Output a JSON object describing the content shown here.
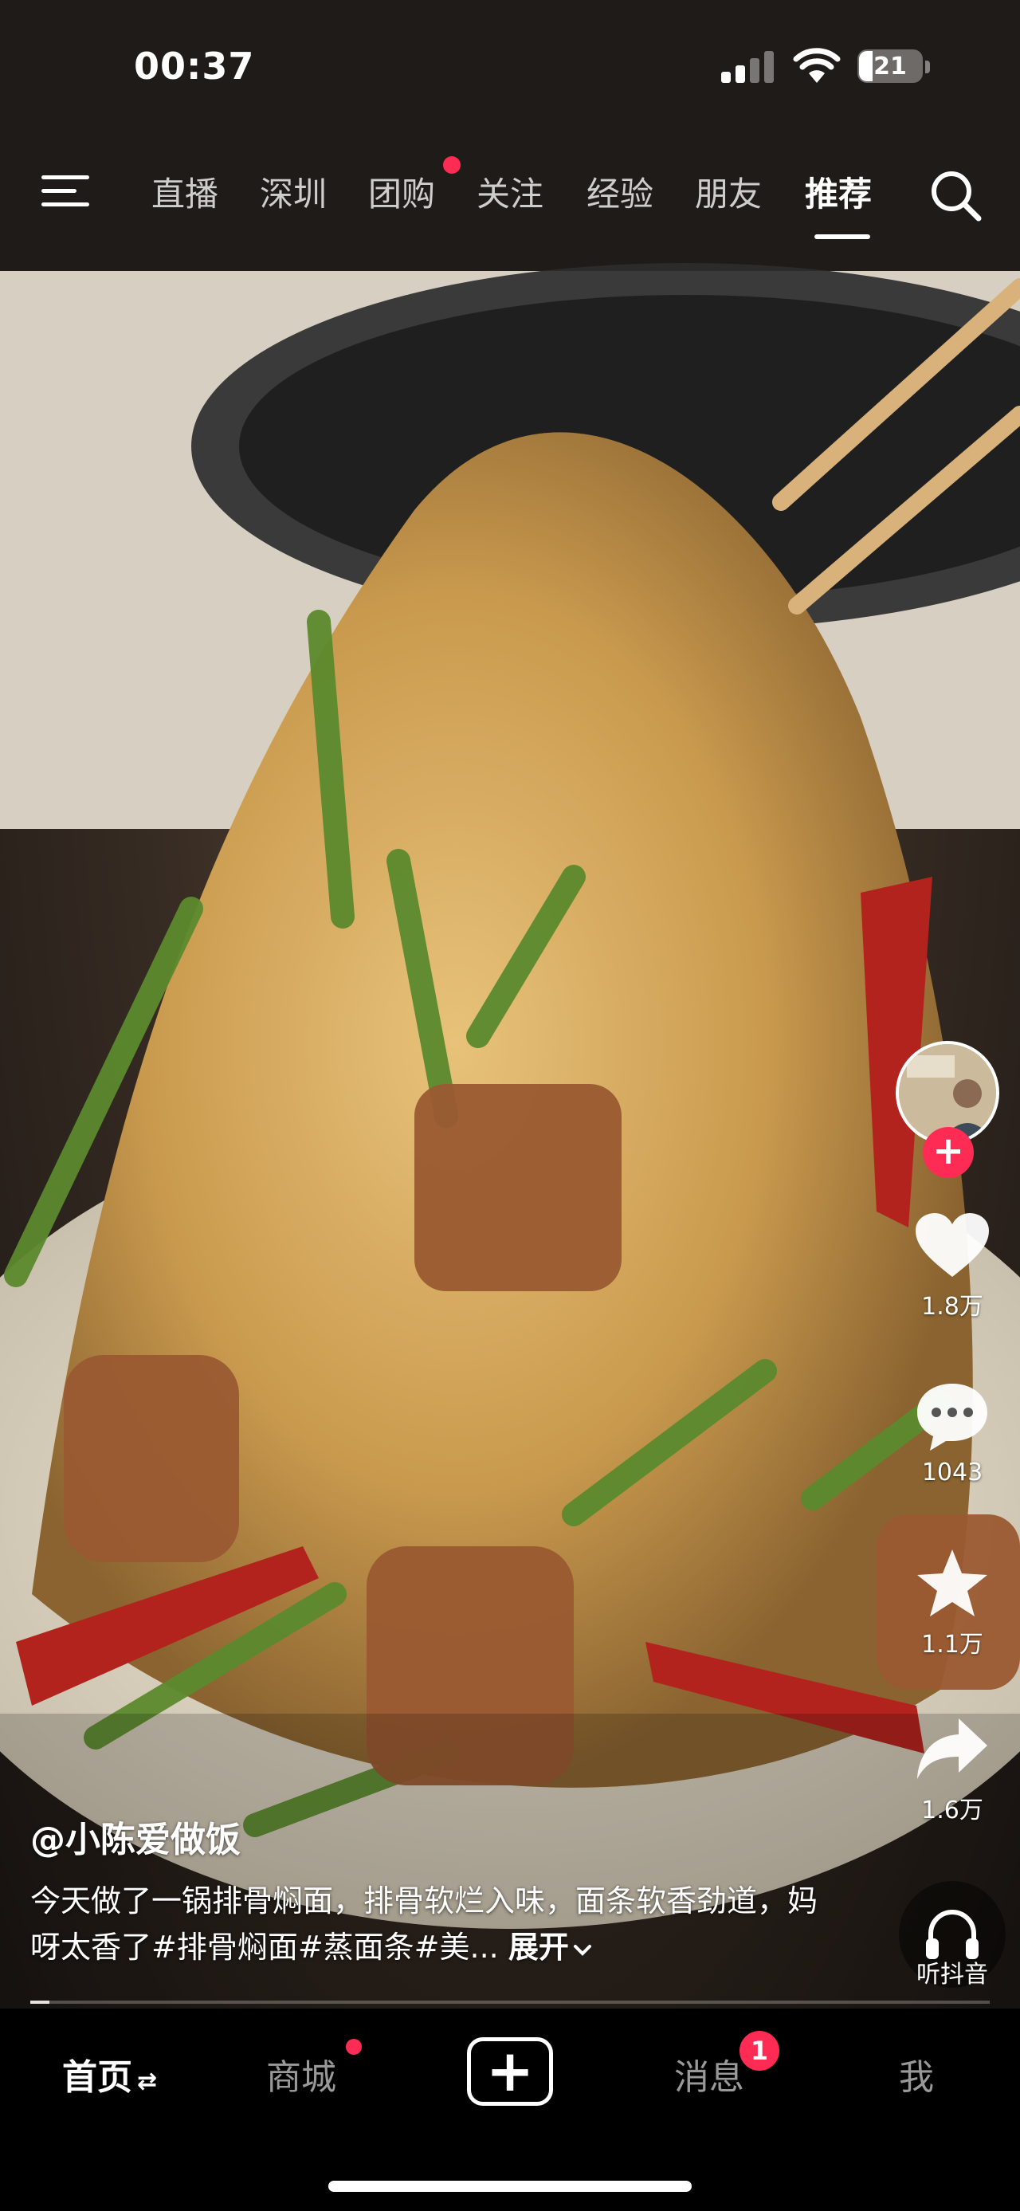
{
  "status_bar": {
    "time": "00:37",
    "battery": "21"
  },
  "top_nav": {
    "tabs": [
      "直播",
      "深圳",
      "团购",
      "关注",
      "经验",
      "朋友",
      "推荐"
    ],
    "active_tab": "推荐"
  },
  "video": {
    "author": "@小陈爱做饭",
    "description": "今天做了一锅排骨焖面，排骨软烂入味，面条软香劲道，妈呀太香了#排骨焖面#蒸面条#美...",
    "expand_label": "展开",
    "progress": 0.02
  },
  "right_rail": {
    "likes": "1.8万",
    "comments": "1043",
    "favorites": "1.1万",
    "shares": "1.6万",
    "listen_label": "听抖音",
    "follow_symbol": "+"
  },
  "bottom_nav": {
    "home": "首页",
    "home_switch": "⇄",
    "mall": "商城",
    "create_symbol": "+",
    "messages": "消息",
    "messages_badge": "1",
    "me": "我"
  },
  "colors": {
    "accent": "#fe2c55"
  }
}
